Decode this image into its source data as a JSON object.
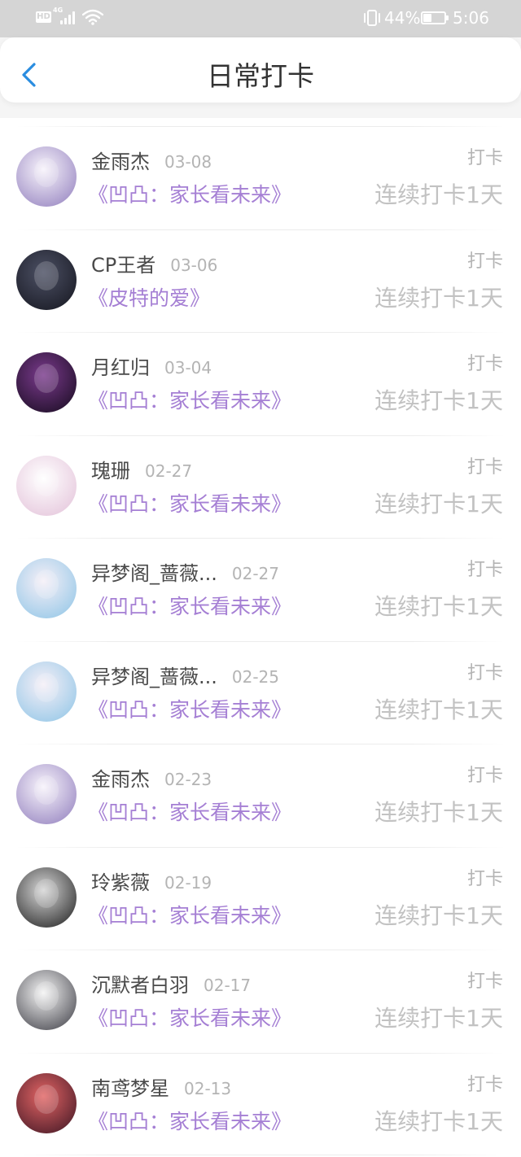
{
  "status_bar": {
    "hd_label": "HD",
    "network_label": "4G",
    "signal_icon": "signal-bars-icon",
    "wifi_icon": "wifi-icon",
    "vibrate_icon": "vibrate-icon",
    "battery_text": "44%",
    "battery_level": 0.44,
    "time": "5:06"
  },
  "header": {
    "back_icon": "chevron-left-icon",
    "title": "日常打卡"
  },
  "theme": {
    "accent": "#2a8de0",
    "book_title": "#a57fd4",
    "name_text": "#4a4a4a",
    "muted_text": "#b4b4b4",
    "streak_text": "#c2c2c2"
  },
  "items": [
    {
      "name": "金雨杰",
      "date": "03-08",
      "book": "《凹凸：家长看未来》",
      "action": "打卡",
      "streak": "连续打卡1天",
      "avatar_colors": [
        "#f7f3fb",
        "#8f7cbc"
      ]
    },
    {
      "name": "CP王者",
      "date": "03-06",
      "book": "《皮特的爱》",
      "action": "打卡",
      "streak": "连续打卡1天",
      "avatar_colors": [
        "#4c5064",
        "#14151e"
      ]
    },
    {
      "name": "月红归",
      "date": "03-04",
      "book": "《凹凸：家长看未来》",
      "action": "打卡",
      "streak": "连续打卡1天",
      "avatar_colors": [
        "#7a3a8c",
        "#140a1c"
      ]
    },
    {
      "name": "瑰珊",
      "date": "02-27",
      "book": "《凹凸：家长看未来》",
      "action": "打卡",
      "streak": "连续打卡1天",
      "avatar_colors": [
        "#ffffff",
        "#e2c0d8"
      ]
    },
    {
      "name": "异梦阁_蔷薇...",
      "date": "02-27",
      "book": "《凹凸：家长看未来》",
      "action": "打卡",
      "streak": "连续打卡1天",
      "avatar_colors": [
        "#f5eff7",
        "#8cc4e6"
      ]
    },
    {
      "name": "异梦阁_蔷薇...",
      "date": "02-25",
      "book": "《凹凸：家长看未来》",
      "action": "打卡",
      "streak": "连续打卡1天",
      "avatar_colors": [
        "#f5eff7",
        "#8cc4e6"
      ]
    },
    {
      "name": "金雨杰",
      "date": "02-23",
      "book": "《凹凸：家长看未来》",
      "action": "打卡",
      "streak": "连续打卡1天",
      "avatar_colors": [
        "#f7f3fb",
        "#8f7cbc"
      ]
    },
    {
      "name": "玲紫薇",
      "date": "02-19",
      "book": "《凹凸：家长看未来》",
      "action": "打卡",
      "streak": "连续打卡1天",
      "avatar_colors": [
        "#d6d6d6",
        "#1a1a1a"
      ]
    },
    {
      "name": "沉默者白羽",
      "date": "02-17",
      "book": "《凹凸：家长看未来》",
      "action": "打卡",
      "streak": "连续打卡1天",
      "avatar_colors": [
        "#f4f4f4",
        "#3a3a42"
      ]
    },
    {
      "name": "南鸢梦星",
      "date": "02-13",
      "book": "《凹凸：家长看未来》",
      "action": "打卡",
      "streak": "连续打卡1天",
      "avatar_colors": [
        "#e26464",
        "#3a1422"
      ]
    }
  ]
}
